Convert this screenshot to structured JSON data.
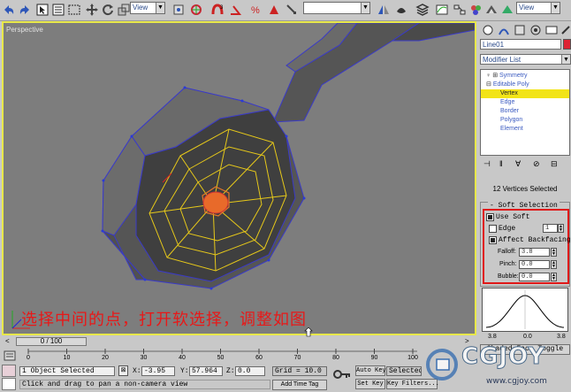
{
  "toolbar": {
    "view_dropdown_1": "View",
    "view_dropdown_2": "View",
    "selection_set": ""
  },
  "viewport": {
    "label": "Perspective",
    "caption": "选择中间的点，打开软选择，调整如图"
  },
  "command_panel": {
    "object_name": "Line01",
    "modifier_list": "Modifier List",
    "stack": [
      {
        "label": "Symmetry",
        "selected": false
      },
      {
        "label": "Editable Poly",
        "selected": false
      },
      {
        "label": "Vertex",
        "selected": true
      },
      {
        "label": "Edge",
        "selected": false
      },
      {
        "label": "Border",
        "selected": false
      },
      {
        "label": "Polygon",
        "selected": false
      },
      {
        "label": "Element",
        "selected": false
      }
    ],
    "selection_info": "12 Vertices Selected",
    "soft_selection_title": "Soft Selection",
    "use_soft": "Use Soft",
    "use_soft_checked": true,
    "edge": "Edge",
    "edge_checked": false,
    "edge_value": "1",
    "affect_backfacing": "Affect Backfacing",
    "affect_backfacing_checked": true,
    "falloff_label": "Falloff:",
    "falloff_value": "3.8",
    "pinch_label": "Pinch:",
    "pinch_value": "0.0",
    "bubble_label": "Bubble:",
    "bubble_value": "0.0",
    "curve_left": "3.8",
    "curve_mid": "0.0",
    "curve_right": "3.8",
    "shaded_face_toggle": "Shaded Face Toggle"
  },
  "timeline": {
    "slider_label": "0 / 100",
    "ticks": [
      "0",
      "10",
      "20",
      "30",
      "40",
      "50",
      "60",
      "70",
      "80",
      "90",
      "100"
    ]
  },
  "status": {
    "objects_selected": "1 Object Selected",
    "x_label": "X:",
    "x_value": "-3.95",
    "y_label": "Y:",
    "y_value": "57.964",
    "z_label": "Z:",
    "z_value": "0.0",
    "grid": "Grid = 10.0",
    "auto_key": "Auto Key",
    "selected": "Selected",
    "set_key": "Set Key",
    "key_filters": "Key Filters...",
    "prompt": "Click and drag to pan a non-camera view",
    "add_time_tag": "Add Time Tag"
  },
  "watermark": {
    "brand": "CGJOY",
    "url": "www.cgjoy.com"
  }
}
